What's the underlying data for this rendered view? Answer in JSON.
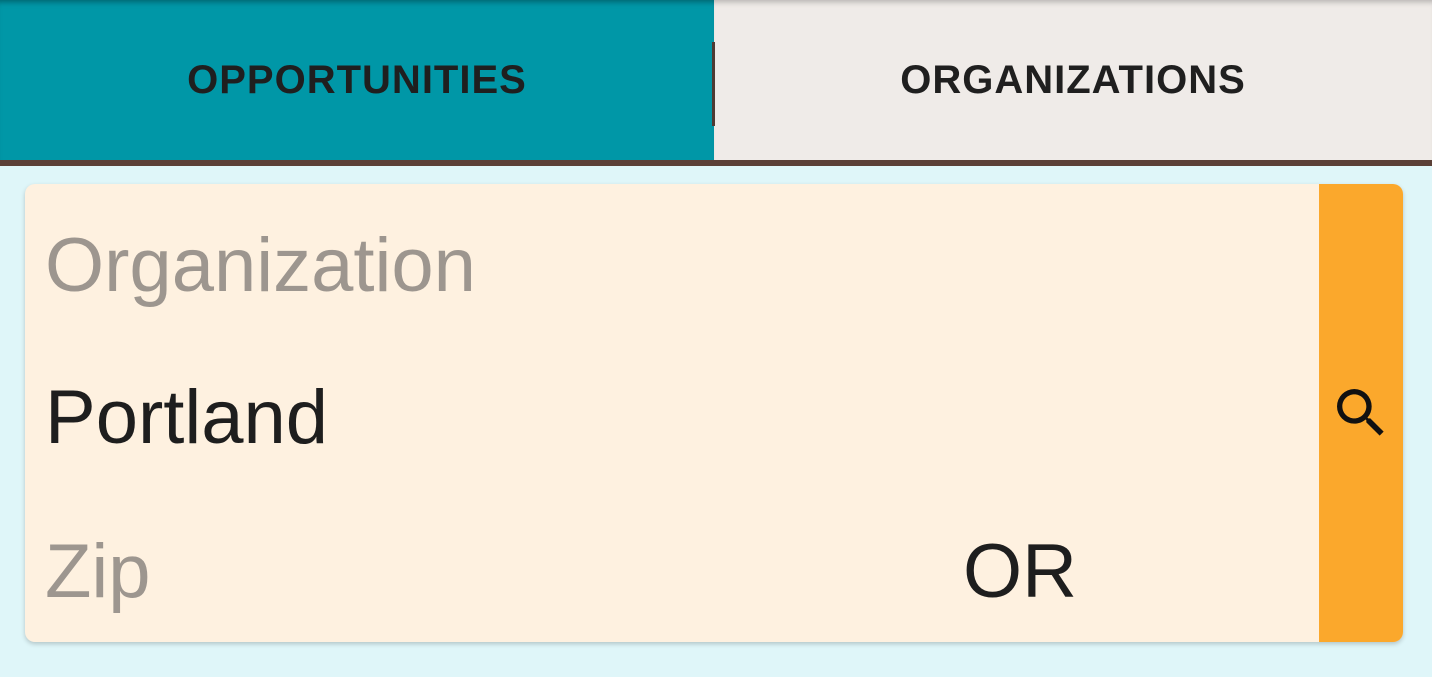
{
  "tabs": [
    {
      "label": "OPPORTUNITIES",
      "active": true,
      "color": "#0097a7"
    },
    {
      "label": "ORGANIZATIONS",
      "active": false,
      "color": "#efebe8"
    }
  ],
  "form": {
    "organization_placeholder": "Organization",
    "city_value": "Portland",
    "zip_placeholder": "Zip",
    "state_value": "OR"
  },
  "search_button": {
    "icon": "search-icon",
    "color": "#fba82c"
  },
  "colors": {
    "background": "#dff6f9",
    "card": "#fef1e0",
    "accent_underline": "#5b4037"
  }
}
